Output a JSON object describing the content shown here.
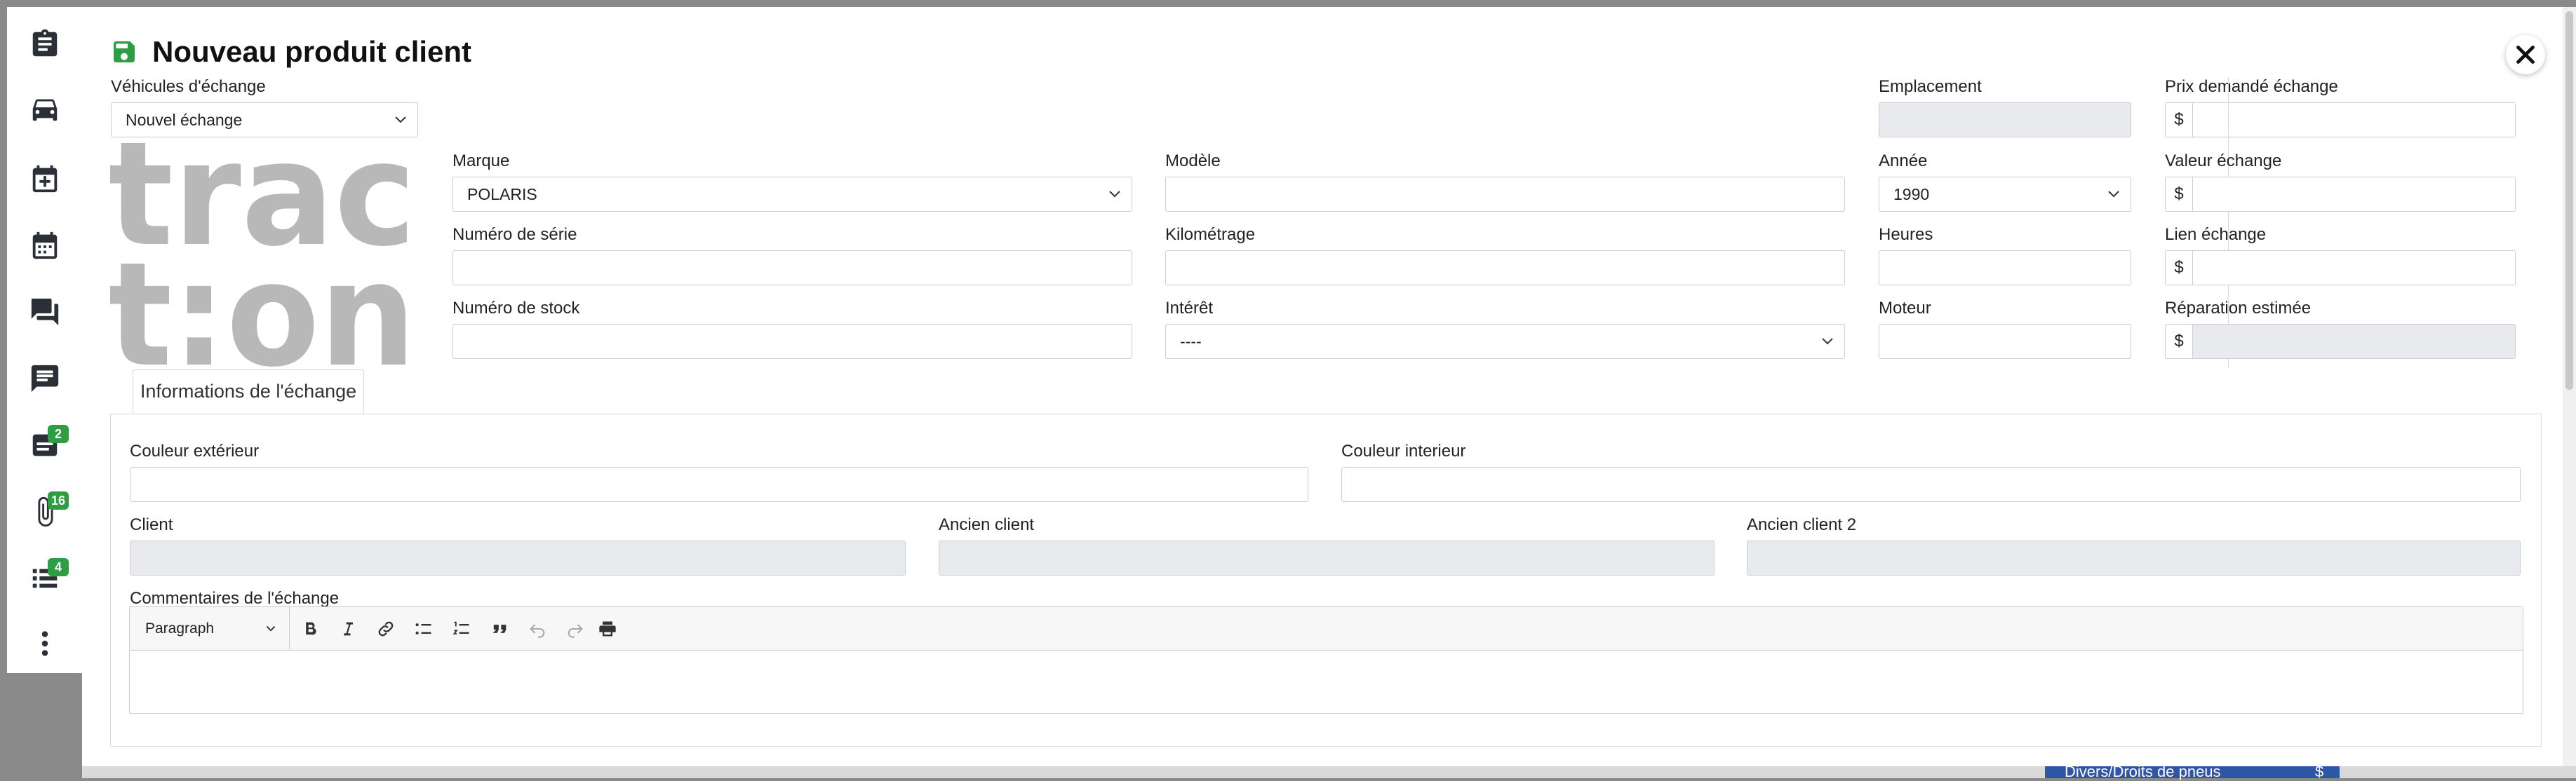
{
  "dialog": {
    "title": "Nouveau produit client",
    "save_icon": "save-icon",
    "close_icon": "close-icon"
  },
  "sidebar": {
    "items": [
      {
        "icon": "clipboard-icon"
      },
      {
        "icon": "car-icon"
      },
      {
        "icon": "calendar-plus-icon"
      },
      {
        "icon": "calendar-icon"
      },
      {
        "icon": "chat-bubbles-icon"
      },
      {
        "icon": "message-lines-icon"
      },
      {
        "icon": "notes-icon",
        "badge": "2"
      },
      {
        "icon": "paperclip-icon",
        "badge": "16"
      },
      {
        "icon": "list-icon",
        "badge": "4"
      },
      {
        "icon": "more-vertical-icon"
      }
    ]
  },
  "form": {
    "vehicles": {
      "label": "Véhicules d'échange",
      "value": "Nouvel échange"
    },
    "emplacement": {
      "label": "Emplacement",
      "value": ""
    },
    "prix_demande": {
      "label": "Prix demandé échange",
      "prefix": "$",
      "value": ""
    },
    "marque": {
      "label": "Marque",
      "value": "POLARIS"
    },
    "modele": {
      "label": "Modèle",
      "value": ""
    },
    "annee": {
      "label": "Année",
      "value": "1990"
    },
    "valeur_echange": {
      "label": "Valeur échange",
      "prefix": "$",
      "value": ""
    },
    "numero_serie": {
      "label": "Numéro de série",
      "value": ""
    },
    "kilometrage": {
      "label": "Kilométrage",
      "value": ""
    },
    "heures": {
      "label": "Heures",
      "value": ""
    },
    "lien_echange": {
      "label": "Lien échange",
      "prefix": "$",
      "value": ""
    },
    "numero_stock": {
      "label": "Numéro de stock",
      "value": ""
    },
    "interet": {
      "label": "Intérêt",
      "value": "----"
    },
    "moteur": {
      "label": "Moteur",
      "value": ""
    },
    "reparation": {
      "label": "Réparation estimée",
      "prefix": "$",
      "value": ""
    }
  },
  "logo": {
    "line1": "trac",
    "line2": "t:on"
  },
  "tabs": [
    {
      "label": "Informations de l'échange",
      "active": true
    }
  ],
  "tab_panel": {
    "couleur_exterieur": {
      "label": "Couleur extérieur",
      "value": ""
    },
    "couleur_interieur": {
      "label": "Couleur interieur",
      "value": ""
    },
    "client": {
      "label": "Client",
      "value": ""
    },
    "ancien_client": {
      "label": "Ancien client",
      "value": ""
    },
    "ancien_client_2": {
      "label": "Ancien client 2",
      "value": ""
    },
    "commentaires": {
      "label": "Commentaires de l'échange"
    }
  },
  "editor": {
    "format_value": "Paragraph",
    "buttons": [
      "bold-icon",
      "italic-icon",
      "link-icon",
      "bulleted-list-icon",
      "numbered-list-icon",
      "blockquote-icon",
      "undo-icon",
      "redo-icon",
      "print-icon"
    ]
  },
  "background": {
    "partial_text": "Divers/Droits de pneus",
    "partial_dollar": "$"
  },
  "colors": {
    "accent_green": "#2e9e44",
    "readonly_bg": "#e8eaee",
    "border": "#c9cdd3",
    "logo_gray": "#b8b8b8"
  }
}
